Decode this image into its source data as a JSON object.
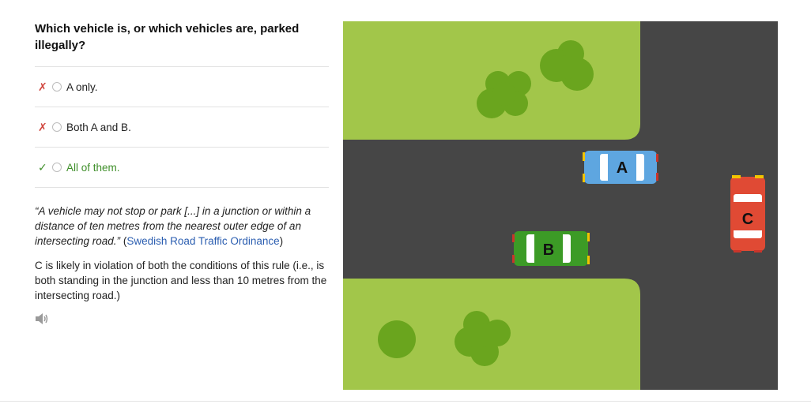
{
  "question": "Which vehicle is, or which vehicles are, parked illegally?",
  "options": [
    {
      "label": "A only.",
      "status": "wrong",
      "mark": "✗"
    },
    {
      "label": "Both A and B.",
      "status": "wrong",
      "mark": "✗"
    },
    {
      "label": "All of them.",
      "status": "correct",
      "mark": "✓"
    }
  ],
  "explanation": {
    "quote": "“A vehicle may not stop or park [...] in a junction or within a distance of ten metres from the nearest outer edge of an intersecting road.”",
    "open_paren": " (",
    "source_link": "Swedish Road Traffic Ordinance",
    "close_paren": ")",
    "detail": "C is likely in violation of both the conditions of this rule (i.e., is both standing in the junction and less than 10 metres from the intersecting road.)"
  },
  "audio_icon": "speaker-icon",
  "scene": {
    "colors": {
      "grass": "#a2c64a",
      "road": "#464646",
      "bush": "#6aa51e"
    },
    "cars": [
      {
        "label": "A",
        "color": "#5ea6e0"
      },
      {
        "label": "B",
        "color": "#3c9b26"
      },
      {
        "label": "C",
        "color": "#e04a34"
      }
    ]
  }
}
